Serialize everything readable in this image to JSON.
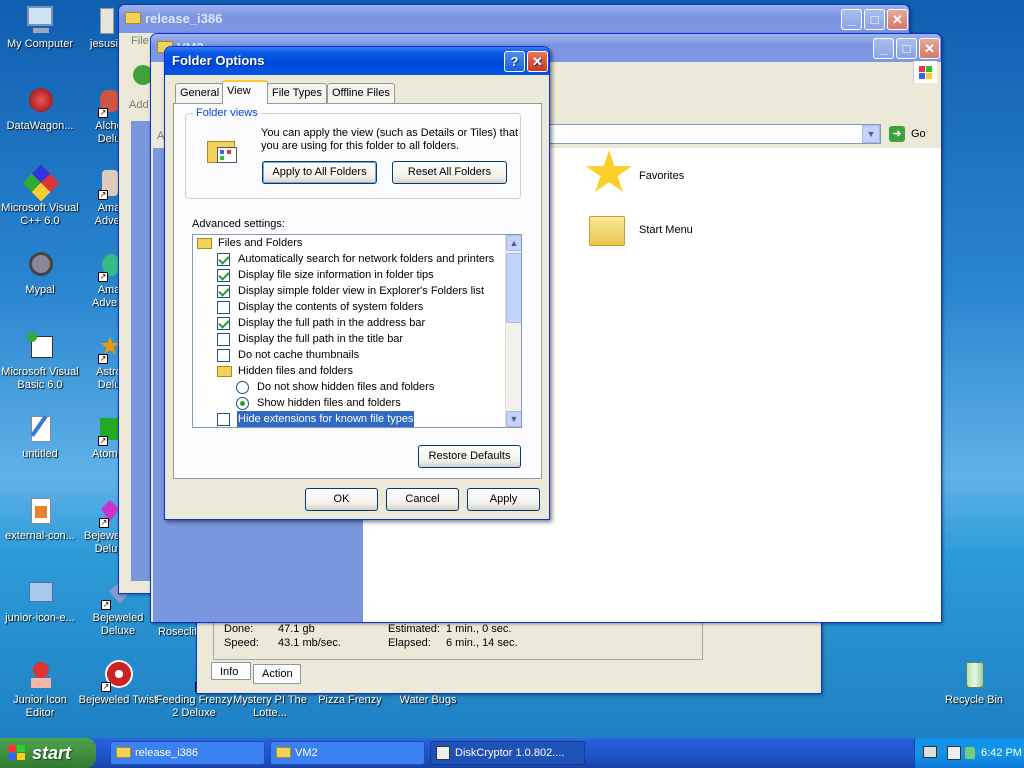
{
  "desktop": {
    "icons_left": [
      {
        "label": "My Computer",
        "icon": "my-computer-icon"
      },
      {
        "label": "DataWagon...",
        "icon": "datawagon-icon"
      },
      {
        "label": "Microsoft Visual C++ 6.0",
        "icon": "visual-cpp-icon"
      },
      {
        "label": "Mypal",
        "icon": "mypal-icon"
      },
      {
        "label": "Microsoft Visual Basic 6.0",
        "icon": "visual-basic-icon"
      },
      {
        "label": "untitled",
        "icon": "paint-icon"
      },
      {
        "label": "external-con...",
        "icon": "document-icon"
      },
      {
        "label": "junior-icon-e...",
        "icon": "junior-icon-editor-icon"
      },
      {
        "label": "Junior Icon Editor",
        "icon": "junior-icon-editor-icon"
      }
    ],
    "icons_col2": [
      {
        "label": "jesusi",
        "icon": "user-icon"
      },
      {
        "label": "Alche Delu",
        "icon": "alchemy-icon"
      },
      {
        "label": "Ama Adver",
        "icon": "amazing-adventures-icon"
      },
      {
        "label": "Ama Advent",
        "icon": "amazing-adventures-icon"
      },
      {
        "label": "Astro Delu",
        "icon": "astro-icon"
      },
      {
        "label": "Atomica",
        "icon": "atomica-icon"
      },
      {
        "label": "Bejewele Delu",
        "icon": "bejeweled-icon"
      },
      {
        "label": "Bejeweled Deluxe",
        "icon": "bejeweled-icon"
      },
      {
        "label": "Bejeweled Twist",
        "icon": "bejeweled-twist-icon"
      }
    ],
    "icons_bottom": [
      {
        "label": "Rosecliff",
        "icon": "rosecliff-icon"
      },
      {
        "label": "Feeding Frenzy 2 Deluxe",
        "icon": "feeding-frenzy-icon"
      },
      {
        "label": "Mystery PI The Lotte...",
        "icon": "mystery-pi-icon"
      },
      {
        "label": "Pizza Frenzy",
        "icon": "pizza-frenzy-icon"
      },
      {
        "label": "Water Bugs",
        "icon": "water-bugs-icon"
      }
    ],
    "recycle_bin": "Recycle Bin"
  },
  "windows": {
    "release": {
      "title": "release_i386",
      "menu_fragment": "File",
      "addr_fragment": "Add"
    },
    "vm2": {
      "title": "VM2",
      "addr_label_fragment": "A",
      "go_label": "Go",
      "items": [
        "Favorites",
        "Start Menu"
      ]
    },
    "diskcryptor": {
      "done_label": "Done:",
      "done_value": "47.1 gb",
      "estimated_label": "Estimated:",
      "estimated_value": "1 min., 0 sec.",
      "speed_label": "Speed:",
      "speed_value": "43.1 mb/sec.",
      "elapsed_label": "Elapsed:",
      "elapsed_value": "6 min., 14 sec.",
      "tabs": [
        "Info",
        "Action"
      ]
    }
  },
  "dialog": {
    "title": "Folder Options",
    "help": "?",
    "close": "✕",
    "tabs": [
      "General",
      "View",
      "File Types",
      "Offline Files"
    ],
    "folder_views": {
      "title": "Folder views",
      "text1": "You can apply the view (such as Details or Tiles) that",
      "text2": "you are using for this folder to all folders.",
      "apply_all": "Apply to All Folders",
      "reset_all": "Reset All Folders"
    },
    "advanced_label": "Advanced settings:",
    "settings": [
      {
        "type": "folder",
        "label": "Files and Folders"
      },
      {
        "type": "check",
        "checked": true,
        "label": "Automatically search for network folders and printers"
      },
      {
        "type": "check",
        "checked": true,
        "label": "Display file size information in folder tips"
      },
      {
        "type": "check",
        "checked": true,
        "label": "Display simple folder view in Explorer's Folders list"
      },
      {
        "type": "check",
        "checked": false,
        "label": "Display the contents of system folders"
      },
      {
        "type": "check",
        "checked": true,
        "label": "Display the full path in the address bar"
      },
      {
        "type": "check",
        "checked": false,
        "label": "Display the full path in the title bar"
      },
      {
        "type": "check",
        "checked": false,
        "label": "Do not cache thumbnails"
      },
      {
        "type": "folder",
        "label": "Hidden files and folders"
      },
      {
        "type": "radio",
        "checked": false,
        "label": "Do not show hidden files and folders"
      },
      {
        "type": "radio",
        "checked": true,
        "label": "Show hidden files and folders"
      },
      {
        "type": "check",
        "checked": false,
        "selected": true,
        "label": "Hide extensions for known file types"
      }
    ],
    "restore_defaults": "Restore Defaults",
    "ok": "OK",
    "cancel": "Cancel",
    "apply": "Apply"
  },
  "taskbar": {
    "start": "start",
    "tasks": [
      {
        "label": "release_i386",
        "active": false
      },
      {
        "label": "VM2",
        "active": false
      },
      {
        "label": "DiskCryptor 1.0.802....",
        "active": true
      }
    ],
    "time": "6:42 PM"
  },
  "colors": {
    "titlebar": "#0054e3",
    "dialog_bg": "#ece9d8",
    "selection": "#316ac5",
    "desktop": "#2a86d0"
  }
}
